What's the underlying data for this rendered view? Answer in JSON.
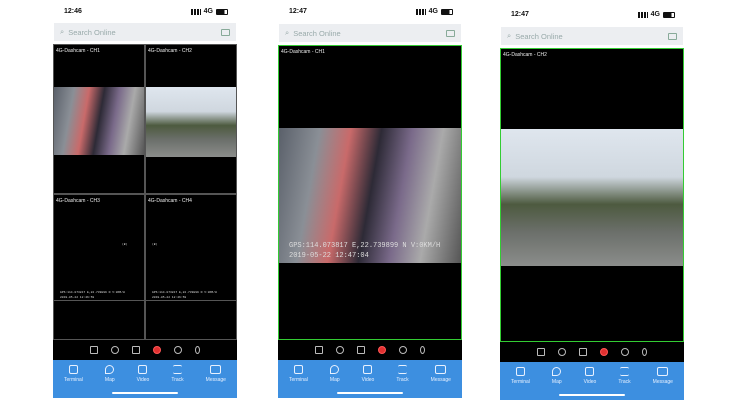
{
  "screens": [
    {
      "time": "12:46",
      "network": "4G",
      "search_placeholder": "Search Online",
      "channels": [
        "4G-Dashcam - CH1",
        "4G-Dashcam - CH2",
        "4G-Dashcam - CH3",
        "4G-Dashcam - CH4"
      ],
      "osd_gps": "GPS:114.073817 E,22.739899 N V:0KM/H",
      "osd_time": "2019-05-22 12:46:59",
      "osd_mark": "(B)"
    },
    {
      "time": "12:47",
      "network": "4G",
      "search_placeholder": "Search Online",
      "channel": "4G-Dashcam - CH1",
      "osd_gps": "GPS:114.073817 E,22.739899 N V:0KM/H",
      "osd_time": "2019-05-22 12:47:04"
    },
    {
      "time": "12:47",
      "network": "4G",
      "search_placeholder": "Search Online",
      "channel": "4G-Dashcam - CH2"
    }
  ],
  "tabs": [
    "Terminal",
    "Map",
    "Video",
    "Track",
    "Message"
  ]
}
